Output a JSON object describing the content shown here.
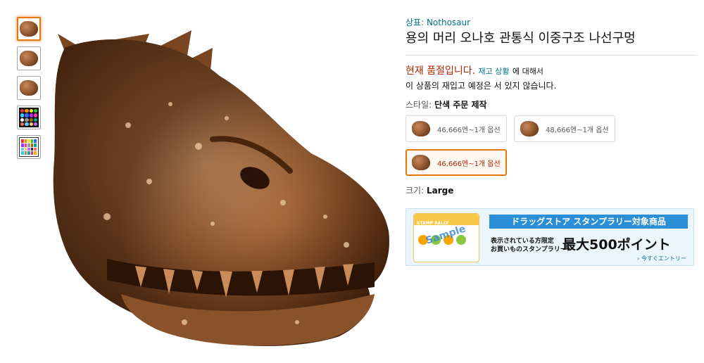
{
  "brand": {
    "label": "상표:",
    "name": "Nothosaur"
  },
  "title": "용의 머리 오나호 관통식 이중구조 나선구멍",
  "availability": {
    "status": "현재 품절입니다.",
    "restock_link": "재고 상황",
    "restock_suffix": "에 대해서",
    "note": "이 상품의 재입고 예정은 서 있지 않습니다."
  },
  "style": {
    "label": "스타일:",
    "value": "단색 주문 제작",
    "options": [
      {
        "text": "46,666엔~1개 옵션",
        "selected": false
      },
      {
        "text": "48,666엔~1개 옵션",
        "selected": false
      },
      {
        "text": "46,666엔~1개 옵션",
        "selected": true
      }
    ]
  },
  "size": {
    "label": "크기:",
    "value": "Large"
  },
  "banner": {
    "card_label": "STAMP RALLY",
    "sample_text": "Sample",
    "headline": "ドラッグストア スタンプラリー対象商品",
    "sub_line1": "表示されている方限定",
    "sub_line2": "お買いものスタンプラリー",
    "big": "最大500ポイント",
    "link": "今すぐエントリー"
  },
  "colors": {
    "accent": "#e77600",
    "price_red": "#B12704",
    "link": "#007185",
    "banner_blue": "#2b8fd6"
  }
}
